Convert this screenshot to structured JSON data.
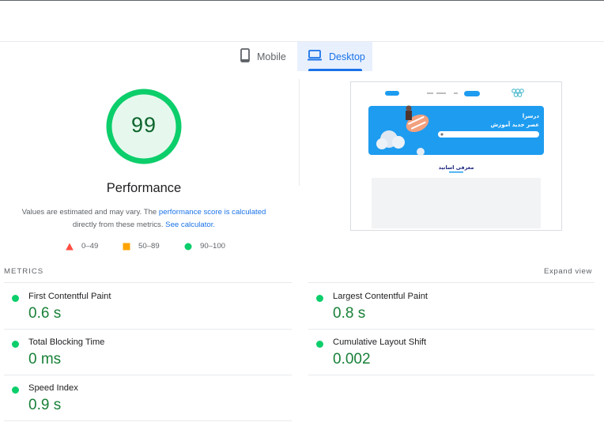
{
  "tabs": [
    {
      "label": "Mobile",
      "icon": "smartphone-icon",
      "selected": false
    },
    {
      "label": "Desktop",
      "icon": "laptop-icon",
      "selected": true
    }
  ],
  "score": {
    "value": "99",
    "title": "Performance",
    "color": "#0cce6b",
    "fill": "#e6f8ed"
  },
  "description": {
    "text_before": "Values are estimated and may vary. The ",
    "link1": "performance score is calculated",
    "text_middle": " directly from these metrics. ",
    "link2": "See calculator."
  },
  "legend": [
    {
      "range": "0–49",
      "color": "#ff4e42",
      "shape": "triangle"
    },
    {
      "range": "50–89",
      "color": "#ffa400",
      "shape": "square"
    },
    {
      "range": "90–100",
      "color": "#0cce6b",
      "shape": "circle"
    }
  ],
  "preview": {
    "hero_title": "درسرا",
    "hero_subtitle": "عصر جدید آموزش",
    "section_heading": "معرفی اساتید",
    "accent_color": "#1e9cf0"
  },
  "metrics": {
    "label": "METRICS",
    "expand_label": "Expand view",
    "fcp": {
      "name": "First Contentful Paint",
      "value": "0.6 s"
    },
    "lcp": {
      "name": "Largest Contentful Paint",
      "value": "0.8 s"
    },
    "tbt": {
      "name": "Total Blocking Time",
      "value": "0 ms"
    },
    "cls": {
      "name": "Cumulative Layout Shift",
      "value": "0.002"
    },
    "si": {
      "name": "Speed Index",
      "value": "0.9 s"
    }
  }
}
